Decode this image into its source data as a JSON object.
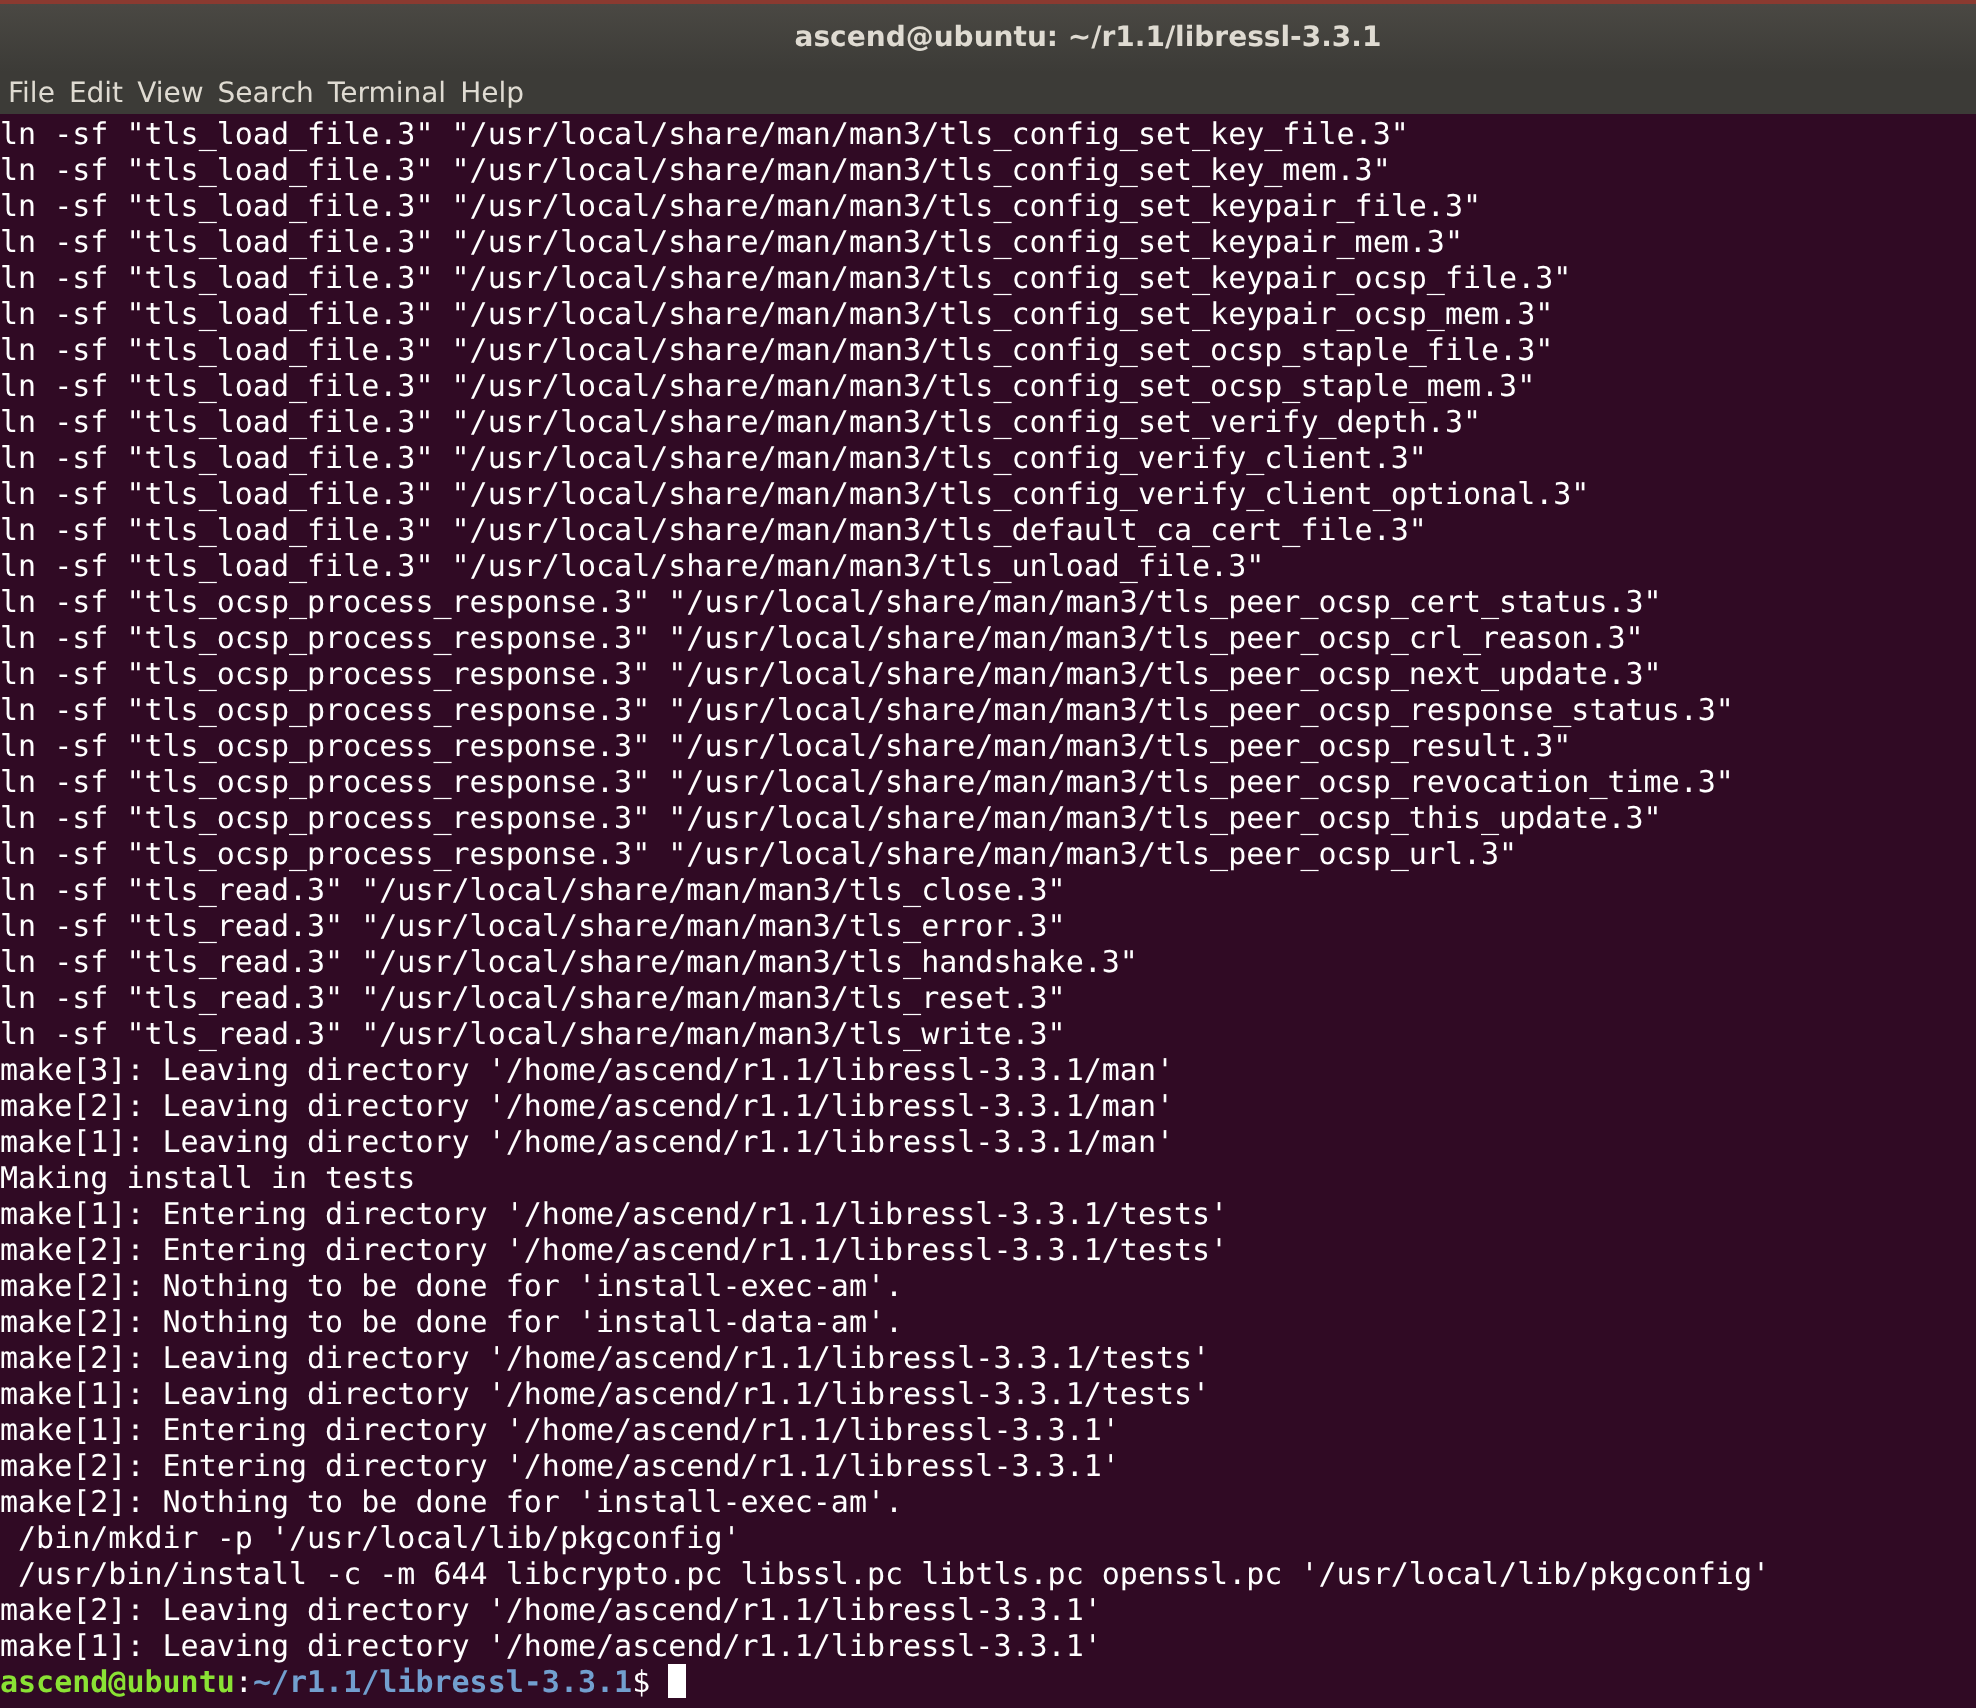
{
  "window": {
    "title": "ascend@ubuntu: ~/r1.1/libressl-3.3.1"
  },
  "menu": [
    "File",
    "Edit",
    "View",
    "Search",
    "Terminal",
    "Help"
  ],
  "lines": [
    "ln -sf \"tls_load_file.3\" \"/usr/local/share/man/man3/tls_config_set_key_file.3\"",
    "ln -sf \"tls_load_file.3\" \"/usr/local/share/man/man3/tls_config_set_key_mem.3\"",
    "ln -sf \"tls_load_file.3\" \"/usr/local/share/man/man3/tls_config_set_keypair_file.3\"",
    "ln -sf \"tls_load_file.3\" \"/usr/local/share/man/man3/tls_config_set_keypair_mem.3\"",
    "ln -sf \"tls_load_file.3\" \"/usr/local/share/man/man3/tls_config_set_keypair_ocsp_file.3\"",
    "ln -sf \"tls_load_file.3\" \"/usr/local/share/man/man3/tls_config_set_keypair_ocsp_mem.3\"",
    "ln -sf \"tls_load_file.3\" \"/usr/local/share/man/man3/tls_config_set_ocsp_staple_file.3\"",
    "ln -sf \"tls_load_file.3\" \"/usr/local/share/man/man3/tls_config_set_ocsp_staple_mem.3\"",
    "ln -sf \"tls_load_file.3\" \"/usr/local/share/man/man3/tls_config_set_verify_depth.3\"",
    "ln -sf \"tls_load_file.3\" \"/usr/local/share/man/man3/tls_config_verify_client.3\"",
    "ln -sf \"tls_load_file.3\" \"/usr/local/share/man/man3/tls_config_verify_client_optional.3\"",
    "ln -sf \"tls_load_file.3\" \"/usr/local/share/man/man3/tls_default_ca_cert_file.3\"",
    "ln -sf \"tls_load_file.3\" \"/usr/local/share/man/man3/tls_unload_file.3\"",
    "ln -sf \"tls_ocsp_process_response.3\" \"/usr/local/share/man/man3/tls_peer_ocsp_cert_status.3\"",
    "ln -sf \"tls_ocsp_process_response.3\" \"/usr/local/share/man/man3/tls_peer_ocsp_crl_reason.3\"",
    "ln -sf \"tls_ocsp_process_response.3\" \"/usr/local/share/man/man3/tls_peer_ocsp_next_update.3\"",
    "ln -sf \"tls_ocsp_process_response.3\" \"/usr/local/share/man/man3/tls_peer_ocsp_response_status.3\"",
    "ln -sf \"tls_ocsp_process_response.3\" \"/usr/local/share/man/man3/tls_peer_ocsp_result.3\"",
    "ln -sf \"tls_ocsp_process_response.3\" \"/usr/local/share/man/man3/tls_peer_ocsp_revocation_time.3\"",
    "ln -sf \"tls_ocsp_process_response.3\" \"/usr/local/share/man/man3/tls_peer_ocsp_this_update.3\"",
    "ln -sf \"tls_ocsp_process_response.3\" \"/usr/local/share/man/man3/tls_peer_ocsp_url.3\"",
    "ln -sf \"tls_read.3\" \"/usr/local/share/man/man3/tls_close.3\"",
    "ln -sf \"tls_read.3\" \"/usr/local/share/man/man3/tls_error.3\"",
    "ln -sf \"tls_read.3\" \"/usr/local/share/man/man3/tls_handshake.3\"",
    "ln -sf \"tls_read.3\" \"/usr/local/share/man/man3/tls_reset.3\"",
    "ln -sf \"tls_read.3\" \"/usr/local/share/man/man3/tls_write.3\"",
    "make[3]: Leaving directory '/home/ascend/r1.1/libressl-3.3.1/man'",
    "make[2]: Leaving directory '/home/ascend/r1.1/libressl-3.3.1/man'",
    "make[1]: Leaving directory '/home/ascend/r1.1/libressl-3.3.1/man'",
    "Making install in tests",
    "make[1]: Entering directory '/home/ascend/r1.1/libressl-3.3.1/tests'",
    "make[2]: Entering directory '/home/ascend/r1.1/libressl-3.3.1/tests'",
    "make[2]: Nothing to be done for 'install-exec-am'.",
    "make[2]: Nothing to be done for 'install-data-am'.",
    "make[2]: Leaving directory '/home/ascend/r1.1/libressl-3.3.1/tests'",
    "make[1]: Leaving directory '/home/ascend/r1.1/libressl-3.3.1/tests'",
    "make[1]: Entering directory '/home/ascend/r1.1/libressl-3.3.1'",
    "make[2]: Entering directory '/home/ascend/r1.1/libressl-3.3.1'",
    "make[2]: Nothing to be done for 'install-exec-am'.",
    " /bin/mkdir -p '/usr/local/lib/pkgconfig'",
    " /usr/bin/install -c -m 644 libcrypto.pc libssl.pc libtls.pc openssl.pc '/usr/local/lib/pkgconfig'",
    "make[2]: Leaving directory '/home/ascend/r1.1/libressl-3.3.1'",
    "make[1]: Leaving directory '/home/ascend/r1.1/libressl-3.3.1'"
  ],
  "prompt": [
    {
      "kind": "user",
      "text": "ascend@ubuntu"
    },
    {
      "kind": "separator",
      "text": ":"
    },
    {
      "kind": "path",
      "text": "~/r1.1/libressl-3.3.1"
    },
    {
      "kind": "symbol",
      "text": "$ "
    }
  ]
}
